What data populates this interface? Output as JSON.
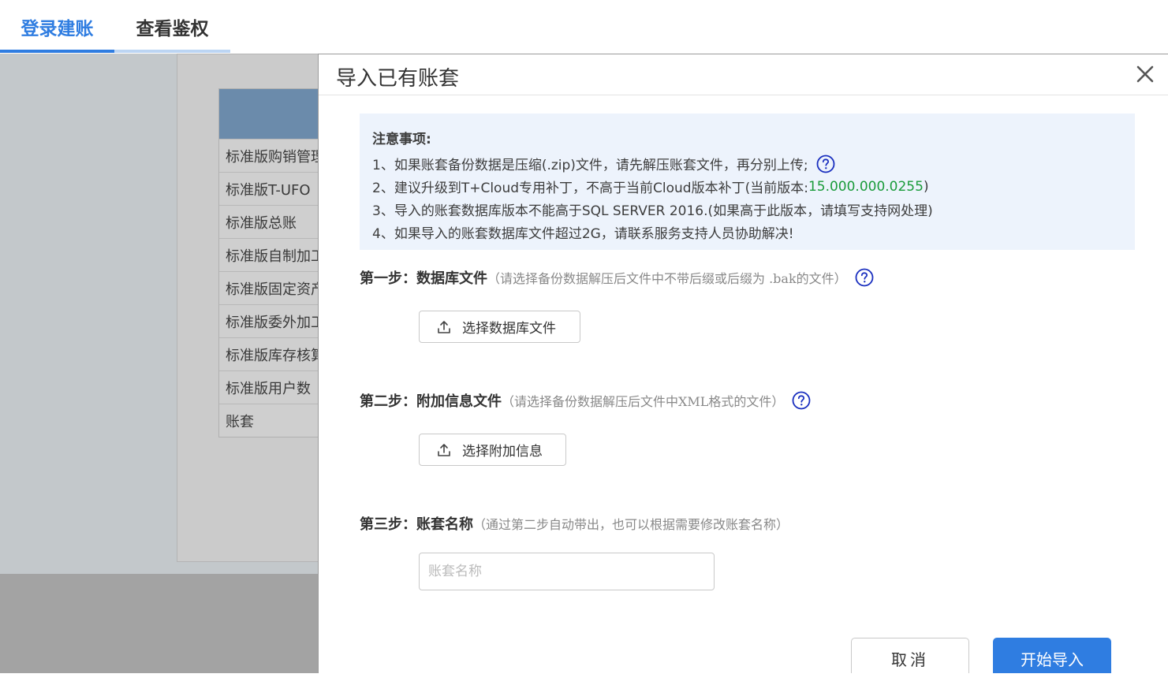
{
  "tabs": [
    {
      "label": "登录建账",
      "active": true
    },
    {
      "label": "查看鉴权",
      "active": false
    }
  ],
  "background_list": {
    "rows": [
      "标准版购销管理",
      "标准版T-UFO",
      "标准版总账",
      "标准版自制加工",
      "标准版固定资产",
      "标准版委外加工",
      "标准版库存核算",
      "标准版用户数",
      "账套"
    ]
  },
  "modal": {
    "title": "导入已有账套",
    "notice": {
      "title": "注意事项:",
      "line1": "1、如果账套备份数据是压缩(.zip)文件，请先解压账套文件，再分别上传;",
      "line2_prefix": "2、建议升级到T+Cloud专用补丁，不高于当前Cloud版本补丁(当前版本:",
      "line2_version": "15.000.000.0255",
      "line2_suffix": ")",
      "line3": "3、导入的账套数据库版本不能高于SQL SERVER 2016.(如果高于此版本，请填写支持网处理)",
      "line4": "4、如果导入的账套数据库文件超过2G，请联系服务支持人员协助解决!"
    },
    "step1": {
      "label": "第一步：数据库文件",
      "hint": "（请选择备份数据解压后文件中不带后缀或后缀为 .bak的文件）",
      "button": "选择数据库文件"
    },
    "step2": {
      "label": "第二步：附加信息文件",
      "hint": "（请选择备份数据解压后文件中XML格式的文件）",
      "button": "选择附加信息"
    },
    "step3": {
      "label": "第三步：账套名称",
      "hint": "（通过第二步自动带出，也可以根据需要修改账套名称）",
      "input_placeholder": "账套名称",
      "input_value": ""
    },
    "cancel_label": "取消",
    "import_label": "开始导入"
  },
  "colors": {
    "accent": "#2f7de1",
    "version_green": "#1a9b3a",
    "help_icon": "#1a2fbf"
  },
  "icons": {
    "close": "close-icon",
    "help": "question-circle-icon",
    "upload": "upload-icon"
  }
}
